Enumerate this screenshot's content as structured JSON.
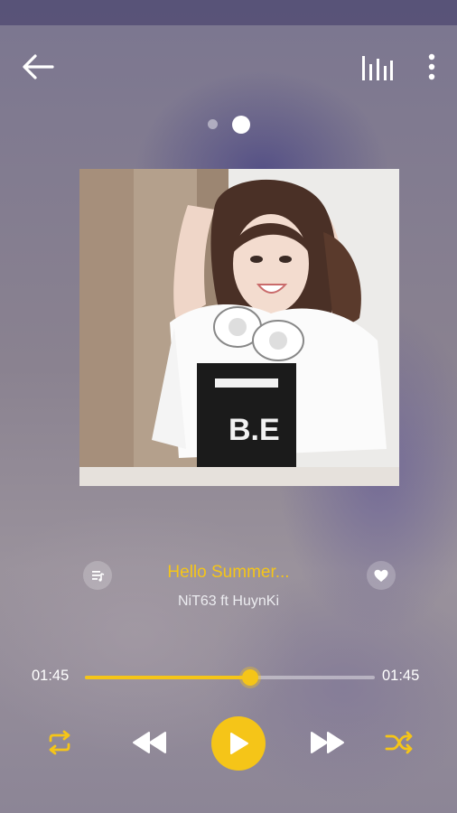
{
  "nav": {
    "back_icon": "arrow-left-icon",
    "equalizer_icon": "equalizer-icon",
    "more_icon": "more-vertical-icon"
  },
  "pager": {
    "page_count": 2,
    "active_page": 2
  },
  "now_playing": {
    "album_art": "album-art-image",
    "title": "Hello Summer...",
    "artist": "NiT63 ft HuynKi",
    "queue_icon": "playlist-icon",
    "favorite_icon": "heart-icon"
  },
  "progress": {
    "current_time": "01:45",
    "total_time": "01:45",
    "fraction": 0.57
  },
  "controls": {
    "repeat_icon": "repeat-icon",
    "rewind_icon": "rewind-icon",
    "play_icon": "play-icon",
    "forward_icon": "fast-forward-icon",
    "shuffle_icon": "shuffle-icon"
  },
  "colors": {
    "accent": "#f5c518",
    "text_primary": "#ffffff",
    "text_secondary": "#ececf0"
  }
}
